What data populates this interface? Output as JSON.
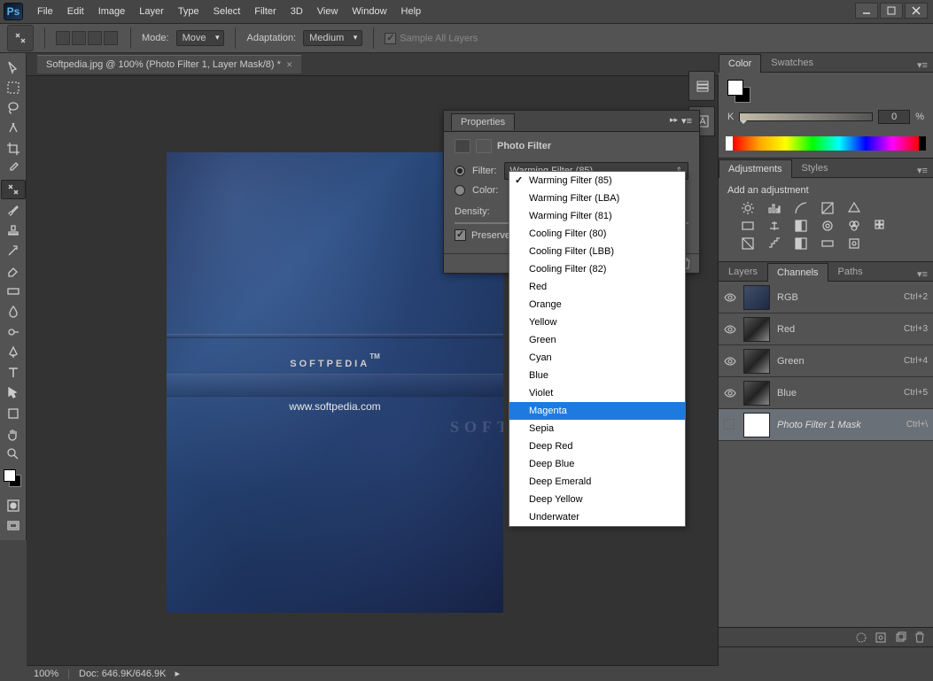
{
  "app": {
    "logo": "Ps"
  },
  "menu": [
    "File",
    "Edit",
    "Image",
    "Layer",
    "Type",
    "Select",
    "Filter",
    "3D",
    "View",
    "Window",
    "Help"
  ],
  "options": {
    "mode_label": "Mode:",
    "mode_value": "Move",
    "adapt_label": "Adaptation:",
    "adapt_value": "Medium",
    "sample_label": "Sample All Layers"
  },
  "doc_tab": "Softpedia.jpg @ 100% (Photo Filter 1, Layer Mask/8) *",
  "canvas": {
    "title": "SOFTPEDIA",
    "tm": "TM",
    "url": "www.softpedia.com",
    "watermark": "SOFTP"
  },
  "status": {
    "zoom": "100%",
    "doc_label": "Doc:",
    "doc_val": "646.9K/646.9K"
  },
  "color_panel": {
    "tabs": [
      "Color",
      "Swatches"
    ],
    "k_label": "K",
    "k_value": "0",
    "k_pct": "%"
  },
  "adjustments": {
    "tabs": [
      "Adjustments",
      "Styles"
    ],
    "title": "Add an adjustment"
  },
  "channels": {
    "tabs": [
      "Layers",
      "Channels",
      "Paths"
    ],
    "rows": [
      {
        "name": "RGB",
        "key": "Ctrl+2",
        "thumb": "rgb",
        "eye": true
      },
      {
        "name": "Red",
        "key": "Ctrl+3",
        "thumb": "gray",
        "eye": true
      },
      {
        "name": "Green",
        "key": "Ctrl+4",
        "thumb": "gray",
        "eye": true
      },
      {
        "name": "Blue",
        "key": "Ctrl+5",
        "thumb": "gray",
        "eye": true
      },
      {
        "name": "Photo Filter 1 Mask",
        "key": "Ctrl+\\",
        "thumb": "white",
        "eye": false,
        "sel": true,
        "ital": true
      }
    ]
  },
  "properties": {
    "tab": "Properties",
    "title": "Photo Filter",
    "filter_label": "Filter:",
    "filter_value": "Warming Filter (85)",
    "color_label": "Color:",
    "density_label": "Density:",
    "preserve_label": "Preserve Luminosity"
  },
  "filter_dropdown": {
    "items": [
      "Warming Filter (85)",
      "Warming Filter (LBA)",
      "Warming Filter (81)",
      "Cooling Filter (80)",
      "Cooling Filter (LBB)",
      "Cooling Filter (82)",
      "Red",
      "Orange",
      "Yellow",
      "Green",
      "Cyan",
      "Blue",
      "Violet",
      "Magenta",
      "Sepia",
      "Deep Red",
      "Deep Blue",
      "Deep Emerald",
      "Deep Yellow",
      "Underwater"
    ],
    "checked": "Warming Filter (85)",
    "highlighted": "Magenta"
  }
}
